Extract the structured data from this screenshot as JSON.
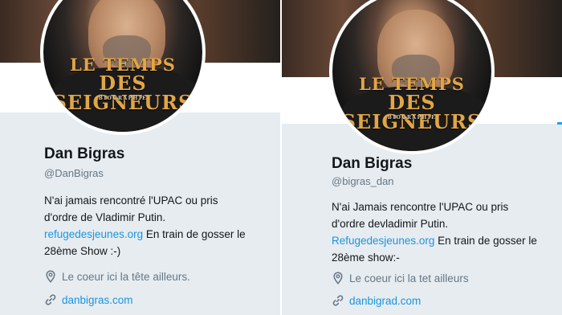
{
  "left": {
    "avatar_text": [
      "LE TEMPS",
      "DES SEIGNEURS",
      "BIOGRAPHIE"
    ],
    "name": "Dan Bigras",
    "handle": "@DanBigras",
    "bio_line1": "N'ai jamais rencontré l'UPAC ou pris",
    "bio_line2": "d'ordre de Vladimir Putin.",
    "bio_link": "refugedesjeunes.org",
    "bio_line3_rest": " En train de gosser le",
    "bio_line4": "28ème Show :-)",
    "location": "Le coeur ici la tête ailleurs.",
    "url": "danbigras.com"
  },
  "right": {
    "avatar_text": [
      "LE TEMPS",
      "DES SEIGNEURS",
      "BIOGRAPHIE"
    ],
    "name": "Dan Bigras",
    "handle": "@bigras_dan",
    "bio_line1": "N'ai Jamais rencontre l'UPAC ou pris",
    "bio_line2": "d'ordre devladimir Putin.",
    "bio_link": "Refugedesjeunes.org",
    "bio_line3_rest": " En train de gosser le",
    "bio_line4": "28ème show:-",
    "location": "Le coeur ici la tet ailleurs",
    "url": "danbigrad.com"
  },
  "colors": {
    "card_bg": "#e6ecf0",
    "link": "#1b95e0",
    "secondary": "#657786",
    "name": "#14171a",
    "book_title": "#e2a646"
  },
  "icons": [
    "location-pin-icon",
    "link-icon"
  ]
}
